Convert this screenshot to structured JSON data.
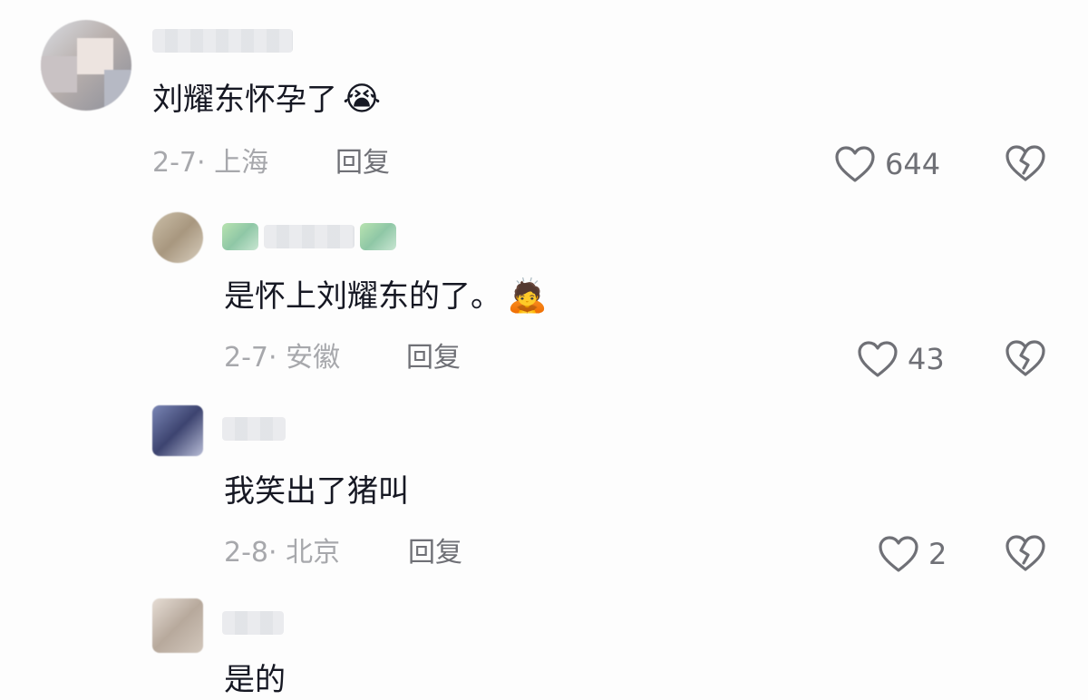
{
  "comments": [
    {
      "text": "刘耀东怀孕了",
      "emoji": "😭",
      "date": "2-7",
      "location": "上海",
      "reply_label": "回复",
      "likes": "644",
      "like_icon": "heart-outline-icon",
      "dislike_icon": "broken-heart-icon"
    },
    {
      "text": "是怀上刘耀东的了。",
      "emoji": "🙇",
      "date": "2-7",
      "location": "安徽",
      "reply_label": "回复",
      "likes": "43",
      "like_icon": "heart-outline-icon",
      "dislike_icon": "broken-heart-icon"
    },
    {
      "text": "我笑出了猪叫",
      "date": "2-8",
      "location": "北京",
      "reply_label": "回复",
      "likes": "2",
      "like_icon": "heart-outline-icon",
      "dislike_icon": "broken-heart-icon"
    },
    {
      "text": "是的"
    }
  ],
  "meta_separator": "·",
  "colors": {
    "text": "#161823",
    "meta": "#a7a8ac",
    "action": "#6f7076",
    "background": "#fdfdfd"
  }
}
